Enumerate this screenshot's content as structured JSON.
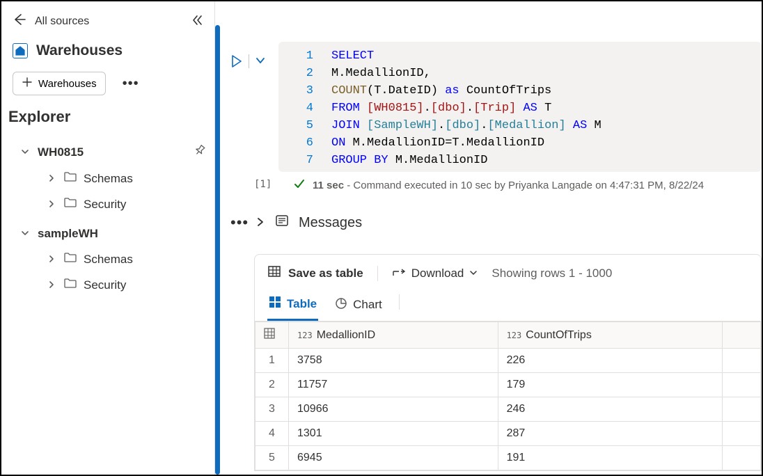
{
  "header": {
    "back_label": "All sources",
    "title": "Warehouses",
    "add_button": "Warehouses"
  },
  "explorer": {
    "title": "Explorer",
    "nodes": [
      {
        "name": "WH0815",
        "children": [
          "Schemas",
          "Security"
        ]
      },
      {
        "name": "sampleWH",
        "children": [
          "Schemas",
          "Security"
        ]
      }
    ]
  },
  "query": {
    "cell_index": "[1]",
    "lines": [
      {
        "num": "1",
        "tokens": [
          {
            "t": "kw",
            "v": "SELECT"
          }
        ]
      },
      {
        "num": "2",
        "tokens": [
          {
            "t": "plain",
            "v": "M.MedallionID,"
          }
        ]
      },
      {
        "num": "3",
        "tokens": [
          {
            "t": "fn",
            "v": "COUNT"
          },
          {
            "t": "plain",
            "v": "(T.DateID) "
          },
          {
            "t": "kw",
            "v": "as"
          },
          {
            "t": "plain",
            "v": " CountOfTrips"
          }
        ]
      },
      {
        "num": "4",
        "tokens": [
          {
            "t": "kw",
            "v": "FROM"
          },
          {
            "t": "plain",
            "v": " "
          },
          {
            "t": "t1",
            "v": "[WH0815]"
          },
          {
            "t": "plain",
            "v": "."
          },
          {
            "t": "t1",
            "v": "[dbo]"
          },
          {
            "t": "plain",
            "v": "."
          },
          {
            "t": "t1",
            "v": "[Trip]"
          },
          {
            "t": "plain",
            "v": " "
          },
          {
            "t": "kw",
            "v": "AS"
          },
          {
            "t": "plain",
            "v": " T"
          }
        ]
      },
      {
        "num": "5",
        "tokens": [
          {
            "t": "kw",
            "v": "JOIN"
          },
          {
            "t": "plain",
            "v": " "
          },
          {
            "t": "t2",
            "v": "[SampleWH]"
          },
          {
            "t": "plain",
            "v": "."
          },
          {
            "t": "t2",
            "v": "[dbo]"
          },
          {
            "t": "plain",
            "v": "."
          },
          {
            "t": "t2",
            "v": "[Medallion]"
          },
          {
            "t": "plain",
            "v": " "
          },
          {
            "t": "kw",
            "v": "AS"
          },
          {
            "t": "plain",
            "v": " M"
          }
        ]
      },
      {
        "num": "6",
        "tokens": [
          {
            "t": "kw",
            "v": "ON"
          },
          {
            "t": "plain",
            "v": " M.MedallionID=T.MedallionID"
          }
        ]
      },
      {
        "num": "7",
        "tokens": [
          {
            "t": "kw",
            "v": "GROUP BY"
          },
          {
            "t": "plain",
            "v": " M.MedallionID"
          }
        ]
      }
    ],
    "status_time": "11 sec",
    "status_text": " - Command executed in 10 sec by Priyanka Langade on 4:47:31 PM, 8/22/24"
  },
  "output": {
    "messages_label": "Messages",
    "save_label": "Save as table",
    "download_label": "Download",
    "showing_label": "Showing rows 1 - 1000",
    "tabs": {
      "table": "Table",
      "chart": "Chart"
    },
    "columns": [
      "MedallionID",
      "CountOfTrips"
    ],
    "col_type_prefix": "123",
    "rows": [
      {
        "i": "1",
        "c": [
          "3758",
          "226"
        ]
      },
      {
        "i": "2",
        "c": [
          "11757",
          "179"
        ]
      },
      {
        "i": "3",
        "c": [
          "10966",
          "246"
        ]
      },
      {
        "i": "4",
        "c": [
          "1301",
          "287"
        ]
      },
      {
        "i": "5",
        "c": [
          "6945",
          "191"
        ]
      }
    ]
  }
}
